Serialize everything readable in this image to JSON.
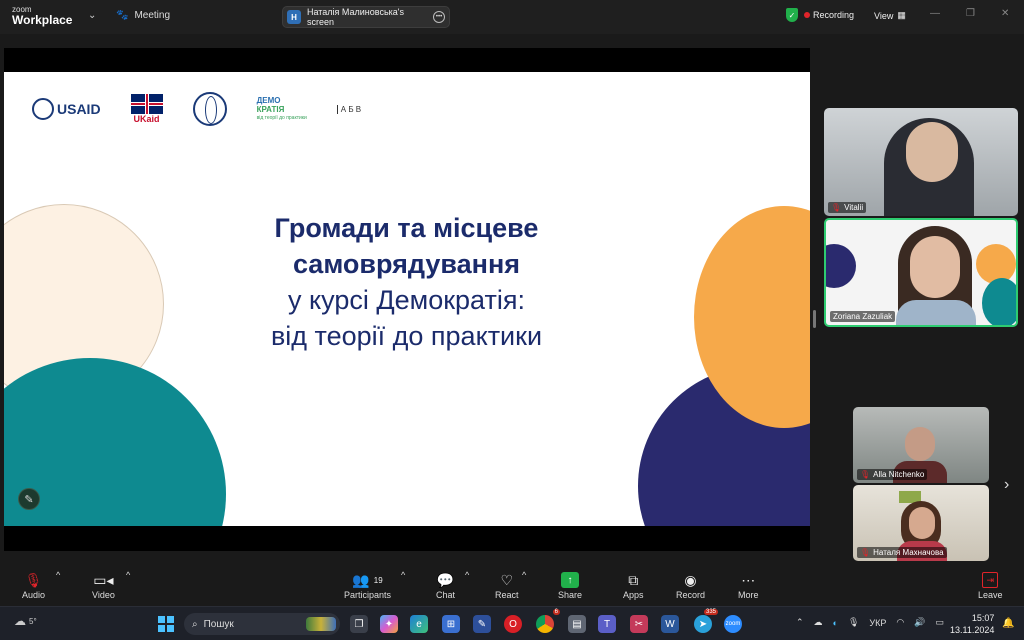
{
  "app": {
    "logo_line1": "zoom",
    "logo_line2": "Workplace",
    "meeting_label": "Meeting",
    "screen_share_initial": "Н",
    "screen_share_label": "Наталія Малиновська's screen",
    "recording_label": "Recording",
    "view_label": "View"
  },
  "slide": {
    "logos": {
      "usaid": "USAID",
      "ukaid": "UKaid",
      "demo_line1": "ДЕМО",
      "demo_line2": "КРАТІЯ",
      "demo_line3": "від теорії до практики",
      "abv": "А Б В"
    },
    "title_line1": "Громади та місцеве",
    "title_line2": "самоврядування",
    "title_line3": "у курсі Демократія:",
    "title_line4": "від теорії до практики",
    "colors": {
      "navy": "#2a2a6e",
      "orange": "#f6a94a",
      "teal": "#0e8a90",
      "cream": "#fdf1e3"
    }
  },
  "participants": [
    {
      "name": "Vitalii",
      "muted": true
    },
    {
      "name": "Zoriana Zazuliak",
      "muted": false,
      "active_speaker": true
    },
    {
      "name": "Alla Nitchenko",
      "muted": true
    },
    {
      "name": "Наталя Махначова",
      "muted": true
    }
  ],
  "toolbar": {
    "audio": "Audio",
    "video": "Video",
    "participants": "Participants",
    "participants_count": "19",
    "chat": "Chat",
    "react": "React",
    "share": "Share",
    "apps": "Apps",
    "record": "Record",
    "more": "More",
    "leave": "Leave"
  },
  "taskbar": {
    "temperature": "5°",
    "search_placeholder": "Пошук",
    "language": "УКР",
    "time": "15:07",
    "date": "13.11.2024",
    "badge_chrome": "6",
    "badge_telegram": "335"
  }
}
